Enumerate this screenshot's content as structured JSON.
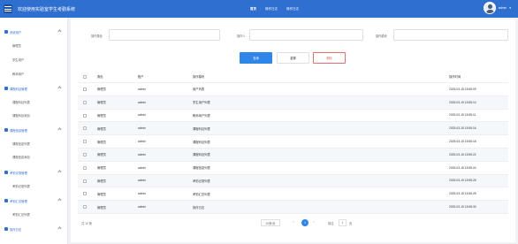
{
  "header": {
    "title": "欢迎使用实验室学生考勤系统",
    "nav": [
      "首页",
      "操作日志",
      "操作日志"
    ],
    "user": "admin"
  },
  "sidebar": {
    "groups": [
      {
        "label": "系统用户",
        "items": [
          "管理员",
          "学生用户",
          "教师用户"
        ]
      },
      {
        "label": "课程科目管理",
        "items": [
          "课程科目列表",
          "课程科目添加"
        ]
      },
      {
        "label": "课程信息管理",
        "items": [
          "课程信息列表",
          "课程信息添加"
        ]
      },
      {
        "label": "考勤记录管理",
        "items": [
          "考勤记录列表"
        ]
      },
      {
        "label": "考勤汇总管理",
        "items": [
          "考勤汇总列表"
        ]
      },
      {
        "label": "操作日志",
        "items": []
      }
    ]
  },
  "filters": {
    "role_label": "操作角色",
    "operator_label": "操作人",
    "module_label": "操作模块"
  },
  "buttons": {
    "search": "查询",
    "reset": "重置",
    "delete": "删除"
  },
  "table": {
    "headers": [
      "角色",
      "账户",
      "操作模块",
      "操作时间"
    ],
    "rows": [
      [
        "管理员",
        "admin",
        "用户列表",
        "2025-03-15 15:55:09"
      ],
      [
        "管理员",
        "admin",
        "学生用户列表",
        "2025-03-15 15:55:10"
      ],
      [
        "管理员",
        "admin",
        "教师用户列表",
        "2025-03-15 15:55:11"
      ],
      [
        "管理员",
        "admin",
        "课程科目列表",
        "2025-03-15 15:55:16"
      ],
      [
        "管理员",
        "admin",
        "课程科目列表",
        "2025-03-15 15:55:18"
      ],
      [
        "管理员",
        "admin",
        "课程科目列表",
        "2025-03-15 15:55:22"
      ],
      [
        "管理员",
        "admin",
        "课程信息列表",
        "2025-03-15 15:55:24"
      ],
      [
        "管理员",
        "admin",
        "考勤记录列表",
        "2025-03-15 15:55:26"
      ],
      [
        "管理员",
        "admin",
        "考勤汇总列表",
        "2025-03-15 15:55:28"
      ],
      [
        "管理员",
        "admin",
        "操作日志",
        "2025-03-15 15:55:30"
      ]
    ]
  },
  "pager": {
    "total": "共 10 条",
    "page_size": "10条/页",
    "prev": "<",
    "current": "1",
    "next": ">",
    "goto_label": "前往",
    "goto_value": "1",
    "page_suffix": "页"
  },
  "colors": {
    "primary": "#2f6fcf",
    "search_button": "#2f86e8",
    "delete_button": "#e56c6c"
  }
}
